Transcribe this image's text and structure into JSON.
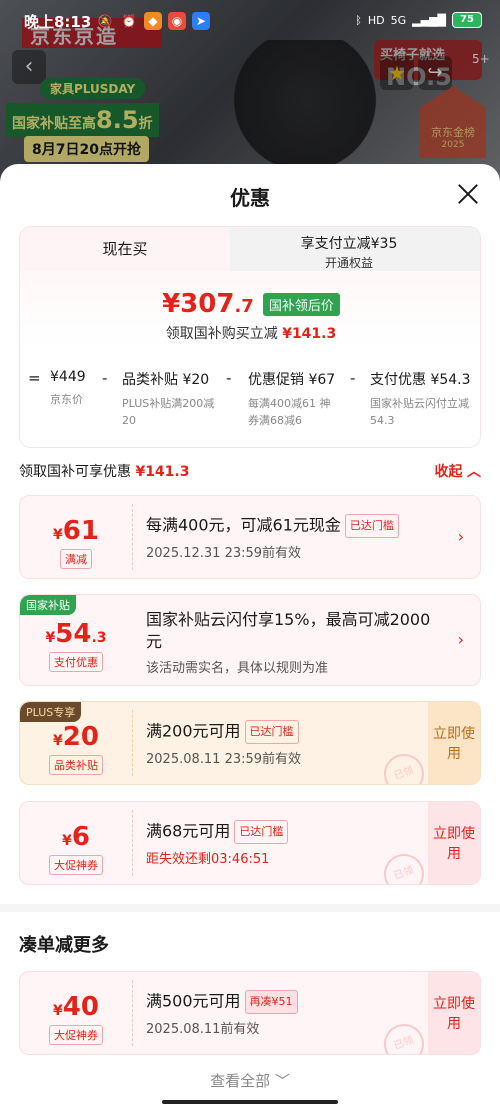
{
  "status_bar": {
    "time": "晚上8:13",
    "network": "5G",
    "battery": "75"
  },
  "background": {
    "brand": "京东京造",
    "banner_tag": "家具PLUSDAY",
    "banner_subsidy_prefix": "国家补贴至高",
    "banner_subsidy_value": "8.5",
    "banner_subsidy_suffix": "折",
    "banner_date": "8月7日20点开抢",
    "rank_text": "买椅子就选",
    "rank_no": "NO.5",
    "award": "京东金榜",
    "award_year": "2025",
    "more": "5+"
  },
  "sheet": {
    "title": "优惠"
  },
  "price_card": {
    "tab_now": "现在买",
    "tab_pay_main": "享支付立减¥35",
    "tab_pay_sub": "开通权益",
    "price_int": "¥307",
    "price_dec": ".7",
    "price_badge": "国补领后价",
    "sub_label": "领取国补购买立减",
    "sub_value": "¥141.3",
    "breakdown": [
      {
        "op": "=",
        "main": "¥449",
        "sub": "京东价"
      },
      {
        "op": "-",
        "main": "品类补贴 ¥20",
        "sub": "PLUS补贴满200减20"
      },
      {
        "op": "-",
        "main": "优惠促销 ¥67",
        "sub": "每满400减61 神券满68减6"
      },
      {
        "op": "-",
        "main": "支付优惠 ¥54.3",
        "sub": "国家补贴云闪付立减54.3"
      }
    ]
  },
  "section": {
    "label": "领取国补可享优惠",
    "value": "¥141.3",
    "collapse": "收起"
  },
  "coupons": [
    {
      "amount": "61",
      "type": "满减",
      "title": "每满400元，可减61元现金",
      "tag": "已达门槛",
      "desc": "2025.12.31 23:59前有效"
    },
    {
      "corner": "国家补贴",
      "amount": "54",
      "amount_dec": ".3",
      "type": "支付优惠",
      "title": "国家补贴云闪付享15%，最高可减2000元",
      "desc": "该活动需实名，具体以规则为准"
    },
    {
      "corner": "PLUS专享",
      "amount": "20",
      "type": "品类补贴",
      "title": "满200元可用",
      "tag": "已达门槛",
      "desc": "2025.08.11 23:59前有效",
      "action": "立即使用"
    },
    {
      "amount": "6",
      "type": "大促神券",
      "title": "满68元可用",
      "tag": "已达门槛",
      "desc": "距失效还剩03:46:51",
      "action": "立即使用"
    }
  ],
  "more": {
    "title": "凑单减更多",
    "coupon": {
      "amount": "40",
      "type": "大促神券",
      "title": "满500元可用",
      "tag": "再凑¥51",
      "desc": "2025.08.11前有效",
      "action": "立即使用"
    },
    "see_all": "查看全部"
  },
  "colors": {
    "accent": "#e2231a",
    "green_badge": "#2ea44f",
    "gold": "#b5701f"
  }
}
